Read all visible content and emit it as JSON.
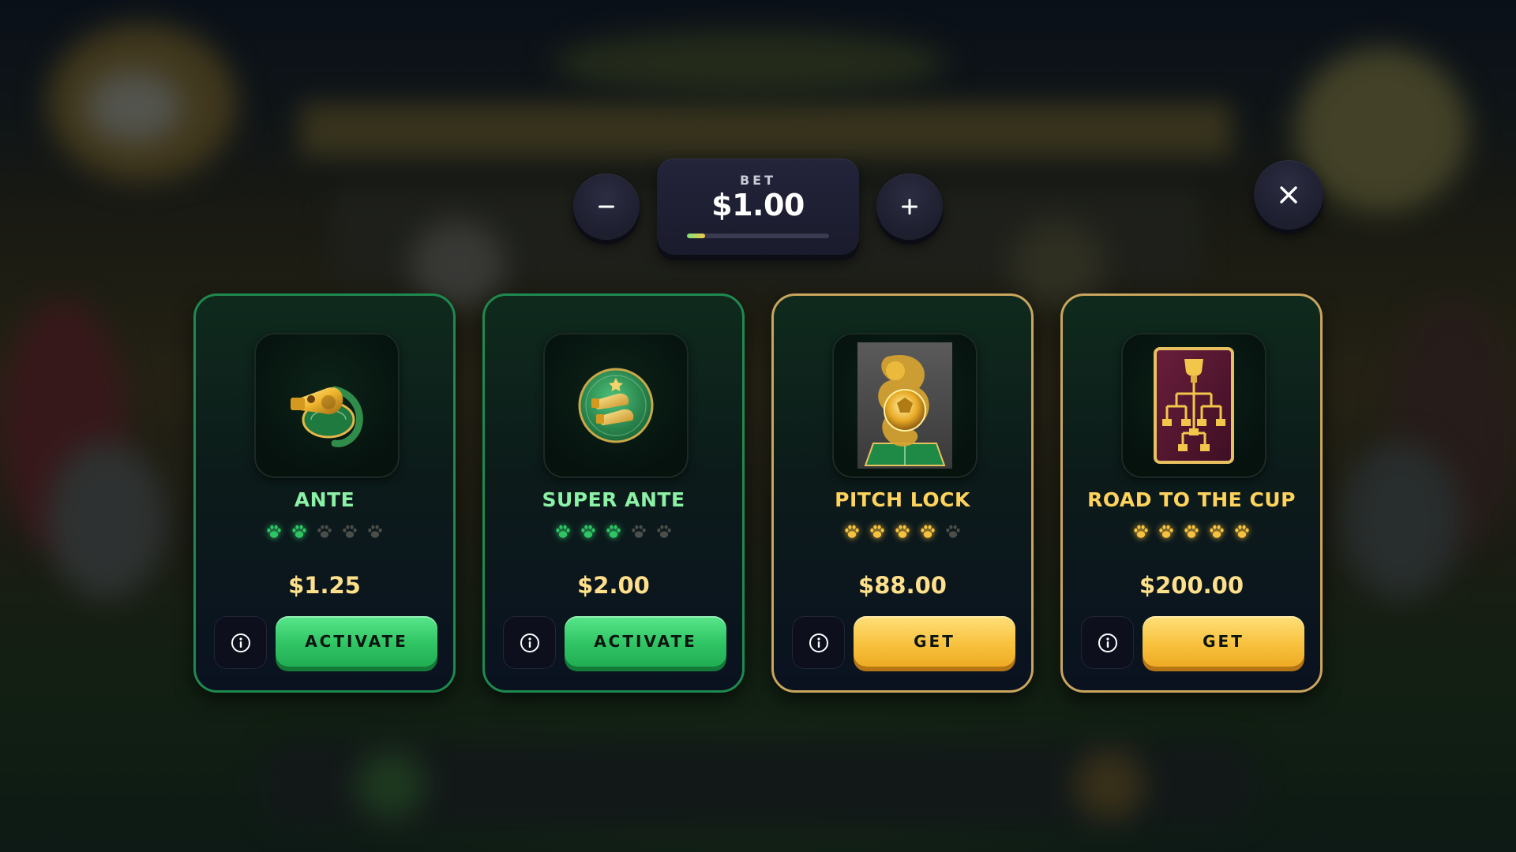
{
  "bet": {
    "label": "BET",
    "value": "$1.00",
    "level": 0.13,
    "decrease_icon": "minus-icon",
    "increase_icon": "plus-icon"
  },
  "close_icon": "close-icon",
  "colors": {
    "green_accent": "#2fc464",
    "gold_accent": "#f8c23f",
    "green_title": "#8bf1a6",
    "gold_title": "#ffd35c",
    "price": "#ffe08a"
  },
  "features": [
    {
      "title": "ANTE",
      "rating": 2,
      "max_rating": 5,
      "price": "$1.25",
      "action": "ACTIVATE",
      "theme": "green",
      "icon": "whistle-icon"
    },
    {
      "title": "SUPER ANTE",
      "rating": 3,
      "max_rating": 5,
      "price": "$2.00",
      "action": "ACTIVATE",
      "theme": "green",
      "icon": "double-whistle-coin-icon"
    },
    {
      "title": "PITCH LOCK",
      "rating": 4,
      "max_rating": 5,
      "price": "$88.00",
      "action": "GET",
      "theme": "gold",
      "icon": "golden-ball-pitch-card-icon"
    },
    {
      "title": "ROAD TO THE CUP",
      "rating": 5,
      "max_rating": 5,
      "price": "$200.00",
      "action": "GET",
      "theme": "gold",
      "icon": "trophy-bracket-card-icon"
    }
  ],
  "info_icon": "info-icon"
}
